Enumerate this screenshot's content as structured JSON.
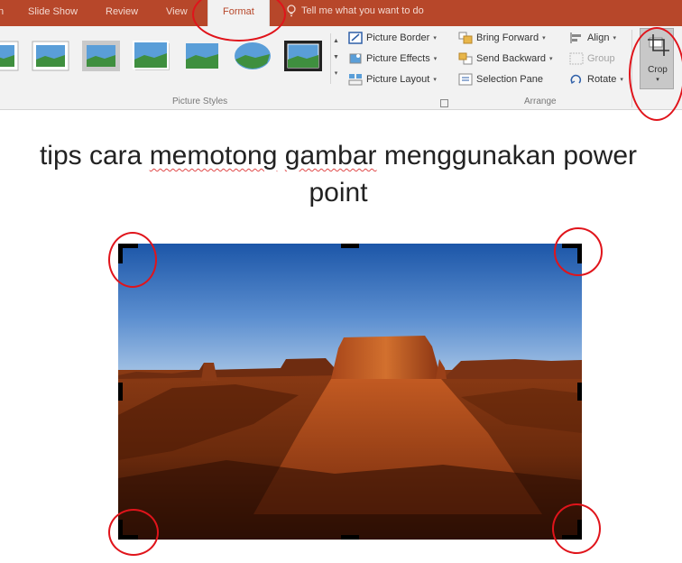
{
  "tabs": [
    {
      "label": "n"
    },
    {
      "label": "Slide Show"
    },
    {
      "label": "Review"
    },
    {
      "label": "View"
    },
    {
      "label": "Format",
      "active": true
    }
  ],
  "tell_me": "Tell me what you want to do",
  "ribbon": {
    "picture_styles_label": "Picture Styles",
    "picture_border": "Picture Border",
    "picture_effects": "Picture Effects",
    "picture_layout": "Picture Layout",
    "bring_forward": "Bring Forward",
    "send_backward": "Send Backward",
    "selection_pane": "Selection Pane",
    "align": "Align",
    "group": "Group",
    "rotate": "Rotate",
    "arrange_label": "Arrange",
    "crop": "Crop"
  },
  "slide": {
    "title_words": [
      "tips cara",
      "memotong",
      "gambar",
      "menggunakan power",
      "point"
    ]
  },
  "colors": {
    "accent": "#b7472a",
    "ribbon_bg": "#f2f2f2",
    "highlight_circle": "#e0141b"
  },
  "icons": [
    "lightbulb-icon",
    "picture-border-icon",
    "picture-effects-icon",
    "picture-layout-icon",
    "bring-forward-icon",
    "send-backward-icon",
    "selection-pane-icon",
    "align-icon",
    "group-icon",
    "rotate-icon",
    "crop-icon"
  ]
}
